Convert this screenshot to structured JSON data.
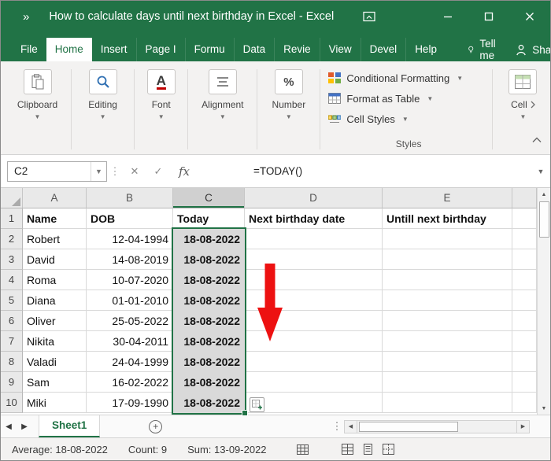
{
  "window": {
    "title": "How to calculate days until next birthday in Excel  -  Excel"
  },
  "ribbon": {
    "tabs": [
      {
        "label": "File"
      },
      {
        "label": "Home"
      },
      {
        "label": "Insert"
      },
      {
        "label": "Page I"
      },
      {
        "label": "Formu"
      },
      {
        "label": "Data"
      },
      {
        "label": "Revie"
      },
      {
        "label": "View"
      },
      {
        "label": "Devel"
      },
      {
        "label": "Help"
      },
      {
        "label": "Tell me"
      }
    ],
    "share_label": "Share",
    "groups": [
      {
        "label": "Clipboard"
      },
      {
        "label": "Editing"
      },
      {
        "label": "Font"
      },
      {
        "label": "Alignment"
      },
      {
        "label": "Number"
      }
    ],
    "styles_group": {
      "label": "Styles",
      "items": [
        "Conditional Formatting",
        "Format as Table",
        "Cell Styles"
      ]
    },
    "cells_group": {
      "label": "Cell"
    }
  },
  "formula_bar": {
    "name_box": "C2",
    "fx_label": "fx",
    "formula": "=TODAY()"
  },
  "grid": {
    "column_headers": [
      "A",
      "B",
      "C",
      "D",
      "E"
    ],
    "selected_column": "C",
    "selected_range": "C2:C10",
    "rows": [
      {
        "num": "1",
        "cells": [
          "Name",
          "DOB",
          "Today",
          "Next birthday date",
          "Untill next birthday"
        ]
      },
      {
        "num": "2",
        "cells": [
          "Robert",
          "12-04-1994",
          "18-08-2022",
          "",
          ""
        ]
      },
      {
        "num": "3",
        "cells": [
          "David",
          "14-08-2019",
          "18-08-2022",
          "",
          ""
        ]
      },
      {
        "num": "4",
        "cells": [
          "Roma",
          "10-07-2020",
          "18-08-2022",
          "",
          ""
        ]
      },
      {
        "num": "5",
        "cells": [
          "Diana",
          "01-01-2010",
          "18-08-2022",
          "",
          ""
        ]
      },
      {
        "num": "6",
        "cells": [
          "Oliver",
          "25-05-2022",
          "18-08-2022",
          "",
          ""
        ]
      },
      {
        "num": "7",
        "cells": [
          "Nikita",
          "30-04-2011",
          "18-08-2022",
          "",
          ""
        ]
      },
      {
        "num": "8",
        "cells": [
          "Valadi",
          "24-04-1999",
          "18-08-2022",
          "",
          ""
        ]
      },
      {
        "num": "9",
        "cells": [
          "Sam",
          "16-02-2022",
          "18-08-2022",
          "",
          ""
        ]
      },
      {
        "num": "10",
        "cells": [
          "Miki",
          "17-09-1990",
          "18-08-2022",
          "",
          ""
        ]
      }
    ]
  },
  "sheet_bar": {
    "active_tab": "Sheet1",
    "add_label": "+"
  },
  "status_bar": {
    "average": "Average: 18-08-2022",
    "count": "Count: 9",
    "sum": "Sum: 13-09-2022"
  },
  "colors": {
    "excel_green": "#217346",
    "arrow_red": "#ED1111"
  }
}
